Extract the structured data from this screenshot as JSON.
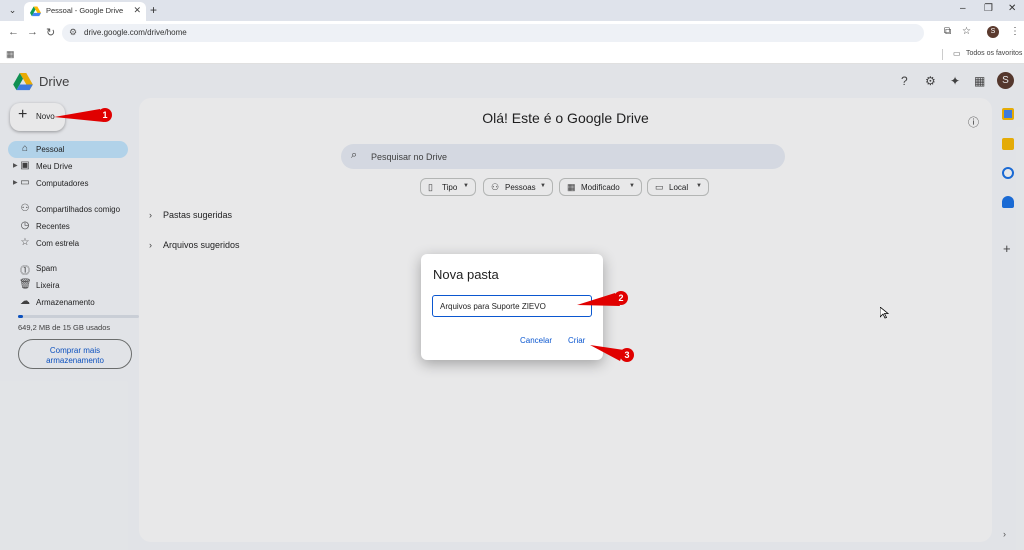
{
  "browser": {
    "tab_title": "Pessoal - Google Drive",
    "url": "drive.google.com/drive/home",
    "profile_initial": "S",
    "bookmarks_label": "Todos os favoritos"
  },
  "app": {
    "logo_text": "Drive",
    "avatar_initial": "S",
    "new_button": "Novo",
    "welcome": "Olá! Este é o Google Drive",
    "search_placeholder": "Pesquisar no Drive"
  },
  "sidebar": {
    "items": [
      {
        "label": "Pessoal"
      },
      {
        "label": "Meu Drive"
      },
      {
        "label": "Computadores"
      },
      {
        "label": "Compartilhados comigo"
      },
      {
        "label": "Recentes"
      },
      {
        "label": "Com estrela"
      },
      {
        "label": "Spam"
      },
      {
        "label": "Lixeira"
      },
      {
        "label": "Armazenamento"
      }
    ],
    "storage_text": "649,2 MB de 15 GB usados",
    "storage_fraction": 0.043,
    "buy_line1": "Comprar mais",
    "buy_line2": "armazenamento"
  },
  "filters": [
    {
      "label": "Tipo"
    },
    {
      "label": "Pessoas"
    },
    {
      "label": "Modificado"
    },
    {
      "label": "Local"
    }
  ],
  "sections": [
    {
      "label": "Pastas sugeridas"
    },
    {
      "label": "Arquivos sugeridos"
    }
  ],
  "dialog": {
    "title": "Nova pasta",
    "input_value": "Arquivos para Suporte ZIEVO",
    "cancel": "Cancelar",
    "create": "Criar"
  },
  "annotations": [
    "1",
    "2",
    "3"
  ],
  "colors": {
    "accent": "#0b57d0",
    "active_nav": "#c2e7ff",
    "callout": "#e00000"
  }
}
